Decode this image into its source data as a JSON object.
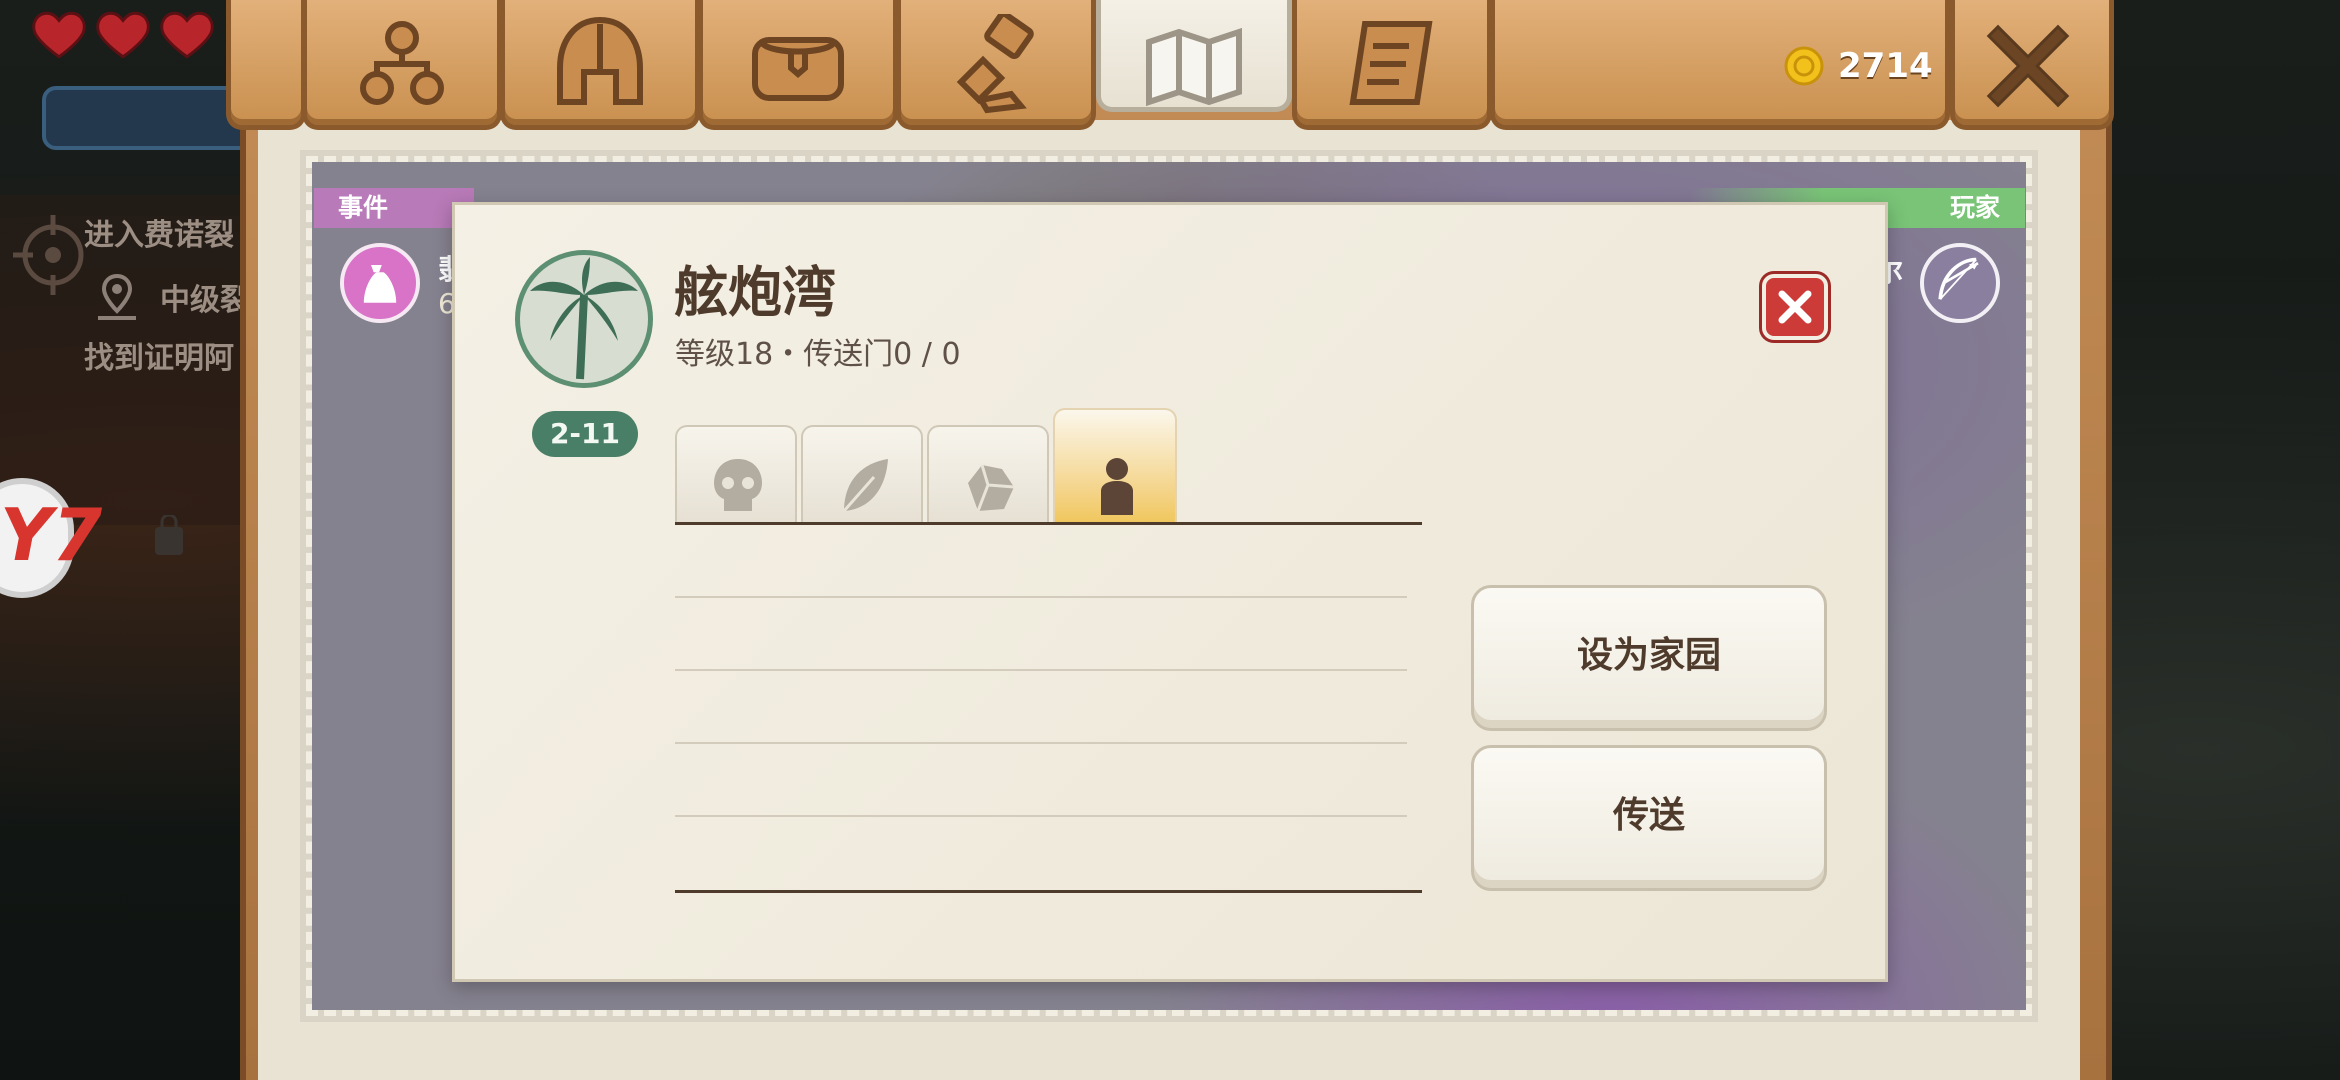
{
  "hud": {
    "quest_lines": [
      "进入费诺裂",
      "中级裂",
      "找到证明阿"
    ],
    "circle_button_label": "Y7"
  },
  "tabs": [
    {
      "name": "skills",
      "icon": "skill-tree-icon",
      "active": false
    },
    {
      "name": "equipment",
      "icon": "helmet-icon",
      "active": false
    },
    {
      "name": "bag",
      "icon": "bag-icon",
      "active": false
    },
    {
      "name": "crafting",
      "icon": "hammer-icon",
      "active": false
    },
    {
      "name": "map",
      "icon": "map-icon",
      "active": true
    },
    {
      "name": "quests",
      "icon": "scroll-icon",
      "active": false
    }
  ],
  "currency": {
    "icon": "gold-coin-icon",
    "value": "2714"
  },
  "map_overlay": {
    "event_label": "事件",
    "player_label": "玩家",
    "event_partial_text_1": "翡",
    "event_partial_text_2": "6.",
    "player_partial_text": "尔"
  },
  "region": {
    "emblem": "palm-tree-emblem",
    "level_range": "2-11",
    "title": "舷炮湾",
    "subtitle": "等级18・传送门0 / 0",
    "category_tabs": [
      {
        "name": "monsters",
        "icon": "skull-icon",
        "active": false
      },
      {
        "name": "resources",
        "icon": "leaf-icon",
        "active": false
      },
      {
        "name": "ores",
        "icon": "ore-icon",
        "active": false
      },
      {
        "name": "npcs",
        "icon": "person-icon",
        "active": true
      }
    ],
    "list_rows": []
  },
  "actions": {
    "set_home": "设为家园",
    "teleport": "传送"
  },
  "colors": {
    "accent_green": "#4a7f67",
    "title_brown": "#4f3b2c",
    "close_red": "#cc3b38",
    "event_purple": "#b87ab8",
    "player_green": "#79c477"
  }
}
